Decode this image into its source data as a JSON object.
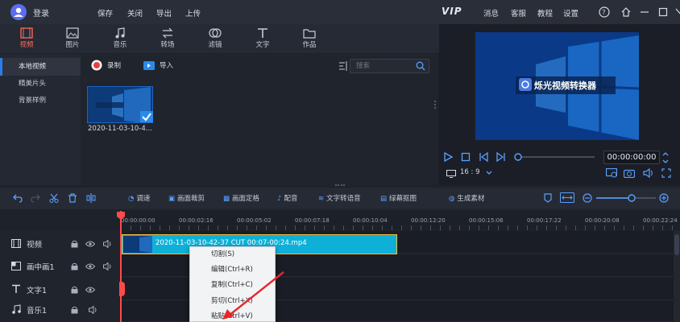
{
  "titlebar": {
    "login": "登录",
    "menu": [
      "保存",
      "关闭",
      "导出",
      "上传"
    ],
    "vip": "VIP",
    "right_menu": [
      "消息",
      "客服",
      "教程",
      "设置"
    ]
  },
  "tabs": [
    {
      "label": "视频",
      "icon": "film-icon"
    },
    {
      "label": "图片",
      "icon": "image-icon"
    },
    {
      "label": "音乐",
      "icon": "music-icon"
    },
    {
      "label": "转场",
      "icon": "transition-icon"
    },
    {
      "label": "滤镜",
      "icon": "filter-icon"
    },
    {
      "label": "文字",
      "icon": "text-icon"
    },
    {
      "label": "作品",
      "icon": "folder-icon"
    }
  ],
  "sidebar": {
    "items": [
      "本地视频",
      "精美片头",
      "背景样例"
    ]
  },
  "media": {
    "record_label": "录制",
    "import_label": "导入",
    "search_placeholder": "搜索",
    "file_name": "2020-11-03-10-4..."
  },
  "preview": {
    "screen_title": "烁光视频转换器",
    "timecode": "00:00:00:00",
    "ratio": "16 : 9"
  },
  "toolbar": {
    "tools": [
      "调速",
      "画面裁剪",
      "画面定格",
      "配音",
      "文字转语音",
      "绿幕抠图",
      "生成素材"
    ]
  },
  "timeline": {
    "ticks": [
      "00:00:00:00",
      "00:00:02:16",
      "00:00:05:02",
      "00:00:07:18",
      "00:00:10:04",
      "00:00:12:20",
      "00:00:15:06",
      "00:00:17:22",
      "00:00:20:08",
      "00:00:22:24"
    ],
    "tracks": [
      {
        "name": "视频",
        "icon": "film-icon"
      },
      {
        "name": "画中画1",
        "icon": "pip-icon"
      },
      {
        "name": "文字1",
        "icon": "text-icon"
      },
      {
        "name": "音乐1",
        "icon": "music-icon"
      }
    ],
    "clip_name": "2020-11-03-10-42-37 CUT 00:07-00:24.mp4"
  },
  "context_menu": {
    "items": [
      "切割(S)",
      "编辑(Ctrl+R)",
      "复制(Ctrl+C)",
      "剪切(Ctrl+X)",
      "粘贴(Ctrl+V)"
    ]
  },
  "colors": {
    "accent": "#2b7de9",
    "active_tab": "#ff6b5c",
    "clip": "#0fb0d8",
    "playhead": "#ff4a4a"
  }
}
